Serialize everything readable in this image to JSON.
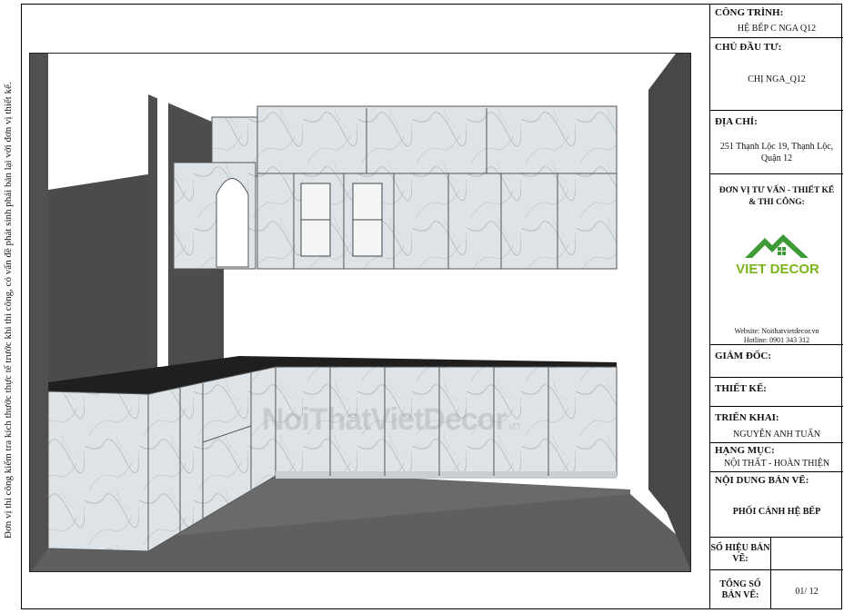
{
  "side_note": "Đơn vị thi công kiểm tra kích thước thực tế trước khi thi công, có vấn đề phát sinh phải bản lại với đơn vị thiết kế.",
  "watermark": {
    "main": "NoiThatVietDecor",
    "suffix": ".vn"
  },
  "title_block": {
    "cong_trinh_label": "CÔNG TRÌNH:",
    "cong_trinh_value": "HỆ BẾP C NGA Q12",
    "chu_dau_tu_label": "CHỦ ĐẦU TƯ:",
    "chu_dau_tu_value": "CHỊ NGA_Q12",
    "dia_chi_label": "ĐỊA CHỈ:",
    "dia_chi_line1": "251 Thạnh Lộc 19, Thạnh Lộc,",
    "dia_chi_line2": "Quận 12",
    "don_vi_line1": "ĐƠN VỊ TƯ VẤN - THIẾT KẾ",
    "don_vi_line2": "& THI CÔNG:",
    "logo_text": "VIET DECOR",
    "website": "Website: Noithatvietdecor.vn",
    "hotline": "Hotline: 0901 343 312",
    "giam_doc_label": "GIÁM ĐỐC:",
    "thiet_ke_label": "THIẾT KẾ:",
    "trien_khai_label": "TRIỂN KHAI:",
    "trien_khai_value": "NGUYỄN ANH TUẤN",
    "hang_muc_label": "HẠNG MỤC:",
    "hang_muc_value": "NỘI THẤT - HOÀN THIỆN",
    "noi_dung_label": "NỘI DUNG BẢN VẼ:",
    "noi_dung_value": "PHỐI CẢNH HỆ BẾP",
    "so_hieu_label_1": "SỐ HIỆU BẢN",
    "so_hieu_label_2": "VẼ:",
    "tong_so_label_1": "TỔNG SỐ",
    "tong_so_label_2": "BẢN VẼ:",
    "tong_so_value": "01/ 12"
  },
  "colors": {
    "wall": "#4a4a4a",
    "floor": "#666666",
    "cabinet": "#dde3e5",
    "countertop": "#222222",
    "logo_green": "#7ab51d"
  }
}
